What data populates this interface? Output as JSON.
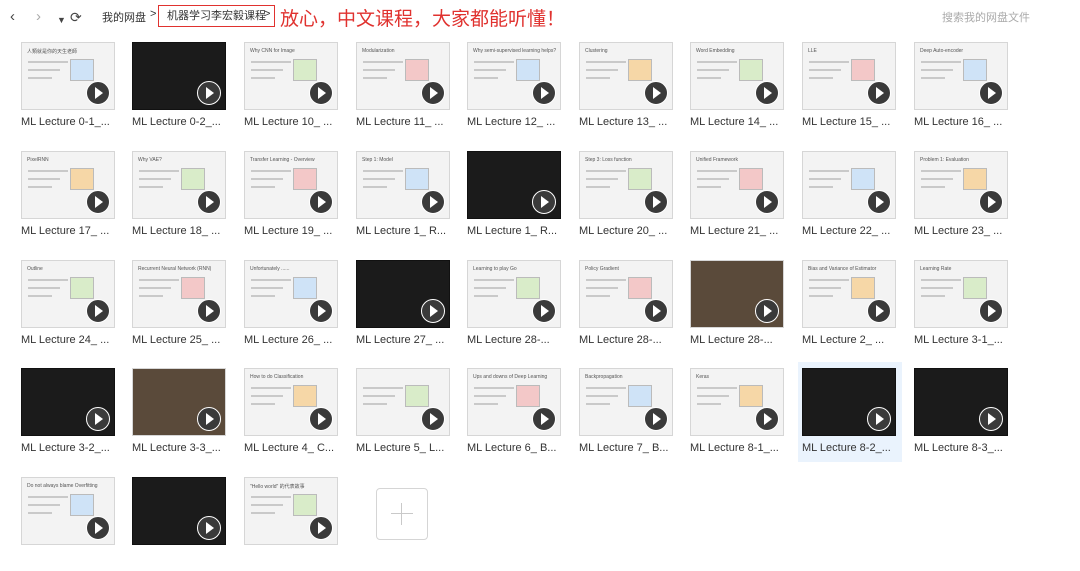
{
  "header": {
    "breadcrumb_root": "我的网盘",
    "breadcrumb_current": "机器学习李宏毅课程",
    "annotation": "放心，中文课程，大家都能听懂！",
    "search_placeholder": "搜索我的网盘文件"
  },
  "icons": {
    "back": "chevron-left-icon",
    "forward": "chevron-right-icon",
    "dropdown": "caret-down-icon",
    "refresh": "refresh-icon",
    "play": "play-icon",
    "add": "plus-icon"
  },
  "files": [
    {
      "label": "ML Lecture 0-1_...",
      "thumb_title": "人類就是你的天生老師"
    },
    {
      "label": "ML Lecture 0-2_...",
      "thumb_title": ""
    },
    {
      "label": "ML Lecture 10_ ...",
      "thumb_title": "Why CNN for Image"
    },
    {
      "label": "ML Lecture 11_ ...",
      "thumb_title": "Modularization"
    },
    {
      "label": "ML Lecture 12_ ...",
      "thumb_title": "Why semi-supervised learning helps?"
    },
    {
      "label": "ML Lecture 13_ ...",
      "thumb_title": "Clustering"
    },
    {
      "label": "ML Lecture 14_ ...",
      "thumb_title": "Word Embedding"
    },
    {
      "label": "ML Lecture 15_ ...",
      "thumb_title": "LLE"
    },
    {
      "label": "ML Lecture 16_ ...",
      "thumb_title": "Deep Auto-encoder"
    },
    {
      "label": "ML Lecture 17_ ...",
      "thumb_title": "PixelRNN"
    },
    {
      "label": "ML Lecture 18_ ...",
      "thumb_title": "Why VAE?"
    },
    {
      "label": "ML Lecture 19_ ...",
      "thumb_title": "Transfer Learning - Overview"
    },
    {
      "label": "ML Lecture 1_ R...",
      "thumb_title": "Step 1: Model"
    },
    {
      "label": "ML Lecture 1_ R...",
      "thumb_title": ""
    },
    {
      "label": "ML Lecture 20_ ...",
      "thumb_title": "Step 3: Loss function"
    },
    {
      "label": "ML Lecture 21_ ...",
      "thumb_title": "Unified Framework"
    },
    {
      "label": "ML Lecture 22_ ...",
      "thumb_title": ""
    },
    {
      "label": "ML Lecture 23_ ...",
      "thumb_title": "Problem 1: Evaluation"
    },
    {
      "label": "ML Lecture 24_ ...",
      "thumb_title": "Outline"
    },
    {
      "label": "ML Lecture 25_ ...",
      "thumb_title": "Recurrent Neural Network (RNN)"
    },
    {
      "label": "ML Lecture 26_ ...",
      "thumb_title": "Unfortunately ......"
    },
    {
      "label": "ML Lecture 27_ ...",
      "thumb_title": ""
    },
    {
      "label": "ML Lecture 28-...",
      "thumb_title": "Learning to play Go"
    },
    {
      "label": "ML Lecture 28-...",
      "thumb_title": "Policy Gradient"
    },
    {
      "label": "ML Lecture 28-...",
      "thumb_title": ""
    },
    {
      "label": "ML Lecture 2_ ...",
      "thumb_title": "Bias and Variance of Estimator"
    },
    {
      "label": "ML Lecture 3-1_...",
      "thumb_title": "Learning Rate"
    },
    {
      "label": "ML Lecture 3-2_...",
      "thumb_title": ""
    },
    {
      "label": "ML Lecture 3-3_...",
      "thumb_title": ""
    },
    {
      "label": "ML Lecture 4_ C...",
      "thumb_title": "How to do Classification"
    },
    {
      "label": "ML Lecture 5_ L...",
      "thumb_title": ""
    },
    {
      "label": "ML Lecture 6_ B...",
      "thumb_title": "Ups and downs of Deep Learning"
    },
    {
      "label": "ML Lecture 7_ B...",
      "thumb_title": "Backpropagation"
    },
    {
      "label": "ML Lecture 8-1_...",
      "thumb_title": "Keras"
    },
    {
      "label": "ML Lecture 8-2_...",
      "thumb_title": ""
    },
    {
      "label": "ML Lecture 8-3_...",
      "thumb_title": ""
    },
    {
      "label": "",
      "thumb_title": "Do not always blame Overfitting"
    },
    {
      "label": "",
      "thumb_title": ""
    },
    {
      "label": "",
      "thumb_title": "\"Hello world\" 的代表故事"
    }
  ],
  "selected_index": 34
}
